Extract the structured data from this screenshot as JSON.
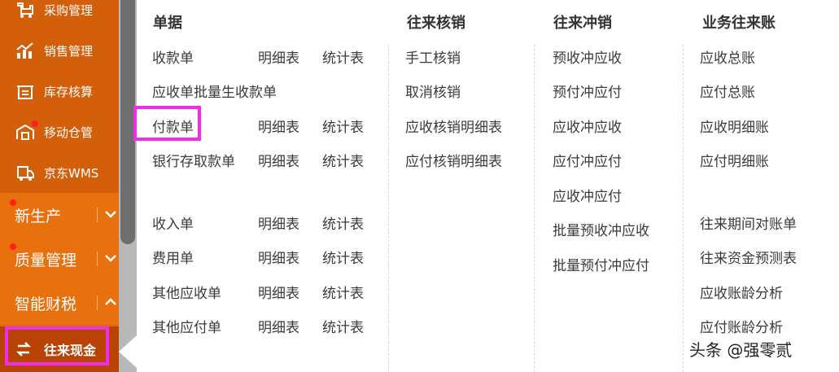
{
  "sidebar": {
    "top_items": [
      {
        "label": "采购管理",
        "icon": "purchase-icon"
      },
      {
        "label": "销售管理",
        "icon": "sales-chart-icon"
      },
      {
        "label": "库存核算",
        "icon": "inventory-icon"
      },
      {
        "label": "移动仓管",
        "icon": "mobile-warehouse-icon"
      },
      {
        "label": "京东WMS",
        "icon": "jd-truck-icon"
      }
    ],
    "sections": [
      {
        "label": "新生产",
        "chevron": "chevron-down-icon"
      },
      {
        "label": "质量管理",
        "chevron": "chevron-down-icon"
      },
      {
        "label": "智能财税",
        "chevron": "chevron-up-icon"
      }
    ],
    "active": {
      "label": "往来现金",
      "icon": "transfer-icon"
    }
  },
  "columns": {
    "documents": {
      "title": "单据",
      "rows": [
        {
          "main": "收款单",
          "detail": "明细表",
          "stats": "统计表"
        },
        {
          "main": "应收单批量生收款单"
        },
        {
          "main": "付款单",
          "detail": "明细表",
          "stats": "统计表"
        },
        {
          "main": "银行存取款单",
          "detail": "明细表",
          "stats": "统计表"
        },
        {
          "main": "收入单",
          "detail": "明细表",
          "stats": "统计表"
        },
        {
          "main": "费用单",
          "detail": "明细表",
          "stats": "统计表"
        },
        {
          "main": "其他应收单",
          "detail": "明细表",
          "stats": "统计表"
        },
        {
          "main": "其他应付单",
          "detail": "明细表",
          "stats": "统计表"
        }
      ]
    },
    "writeoff": {
      "title": "往来核销",
      "items": [
        "手工核销",
        "取消核销",
        "应收核销明细表",
        "应付核销明细表"
      ]
    },
    "offset": {
      "title": "往来冲销",
      "items": [
        "预收冲应收",
        "预付冲应付",
        "应收冲应收",
        "应付冲应付",
        "应收冲应付",
        "批量预收冲应收",
        "批量预付冲应付"
      ]
    },
    "ledger": {
      "title": "业务往来账",
      "items": [
        "应收总账",
        "应付总账",
        "应收明细账",
        "应付明细账",
        "往来期间对账单",
        "往来资金预测表",
        "应收账龄分析",
        "应付账龄分析"
      ]
    }
  },
  "watermark": "头条 @强零贰",
  "colors": {
    "sidebar": "#e06a0e",
    "active": "#b84303",
    "highlight": "#ee2ee8"
  }
}
